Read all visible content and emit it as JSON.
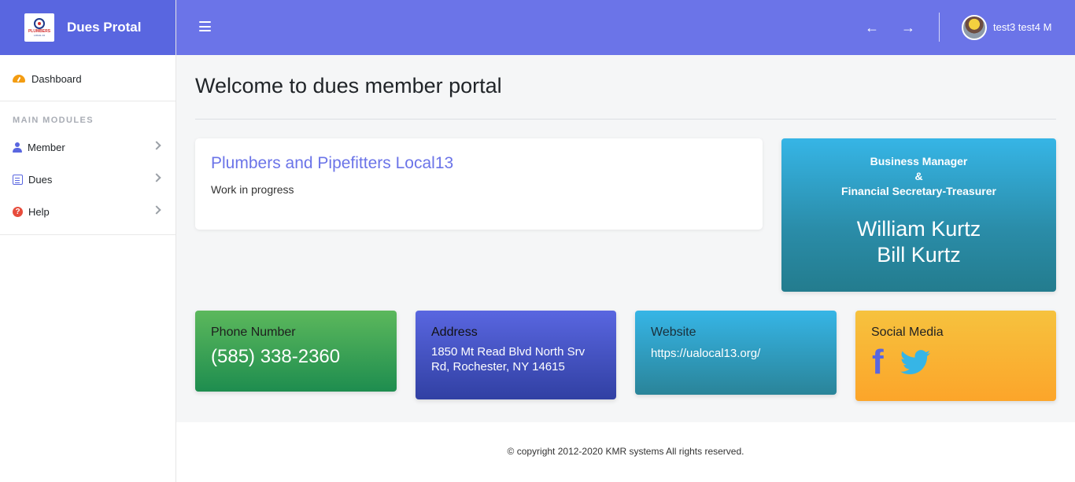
{
  "app": {
    "brand_name": "Dues Protal",
    "logo_text": "PLUMBERS",
    "logo_subtext": "LOCAL 13"
  },
  "sidebar": {
    "dashboard_label": "Dashboard",
    "section_title": "MAIN MODULES",
    "items": [
      {
        "label": "Member",
        "icon": "user-icon"
      },
      {
        "label": "Dues",
        "icon": "list-icon"
      },
      {
        "label": "Help",
        "icon": "question-icon"
      }
    ]
  },
  "header": {
    "user_name": "test3 test4 M",
    "back_icon": "←",
    "forward_icon": "→"
  },
  "main": {
    "title": "Welcome to dues member portal",
    "intro": {
      "heading": "Plumbers and Pipefitters Local13",
      "text": "Work in progress"
    },
    "manager": {
      "role_line1": "Business Manager",
      "role_line2": "&",
      "role_line3": "Financial Secretary-Treasurer",
      "name_line1": "William Kurtz",
      "name_line2": "Bill Kurtz"
    },
    "phone": {
      "title": "Phone Number",
      "value": "(585) 338-2360"
    },
    "address": {
      "title": "Address",
      "value": "1850 Mt Read Blvd North Srv Rd, Rochester, NY 14615"
    },
    "website": {
      "title": "Website",
      "value": "https://ualocal13.org/"
    },
    "social": {
      "title": "Social Media",
      "facebook_glyph": "f"
    }
  },
  "footer": {
    "copyright": "© copyright 2012-2020 KMR systems All rights reserved."
  },
  "colors": {
    "brand": "#5966e0",
    "header": "#6b74e8",
    "accent_green": "#1e8d4f",
    "accent_teal": "#2a8ca8",
    "accent_yellow": "#f6c23e"
  }
}
